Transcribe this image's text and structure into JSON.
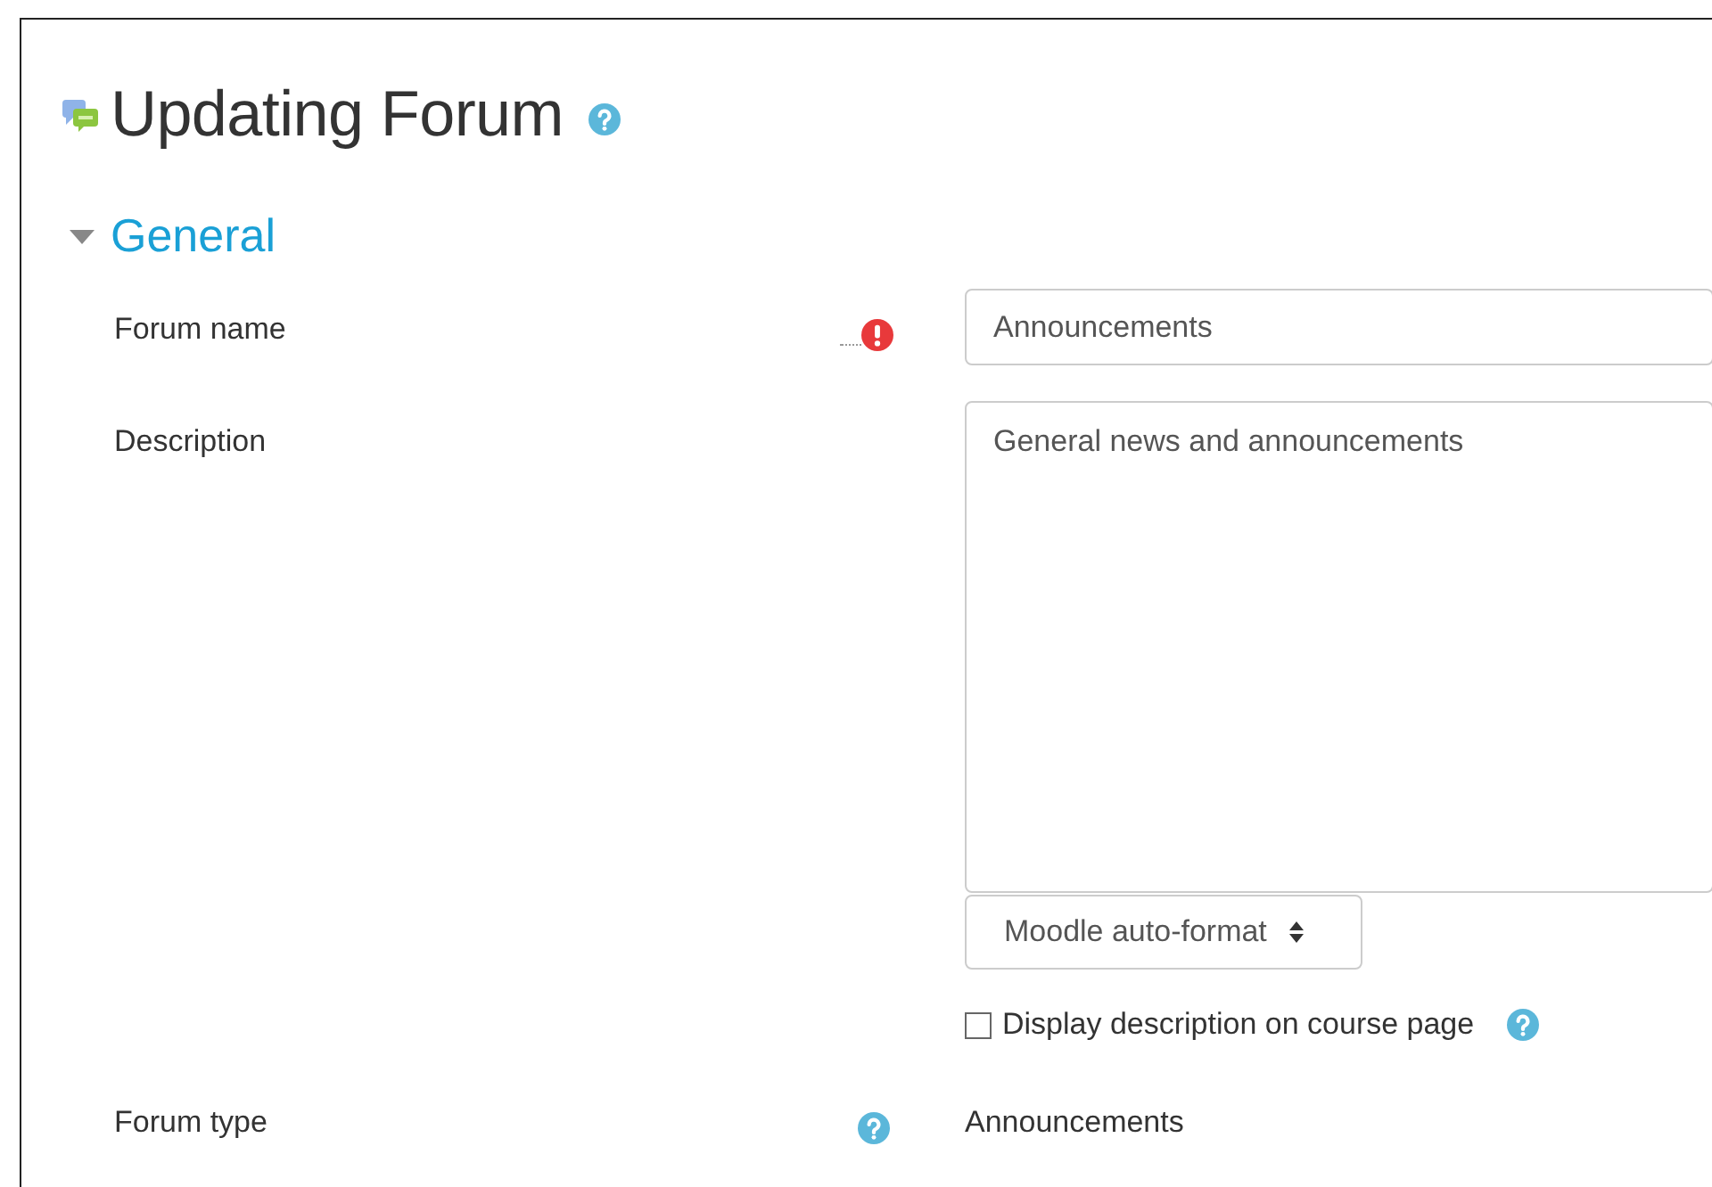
{
  "heading": {
    "title": "Updating Forum",
    "help": true
  },
  "section": {
    "title": "General",
    "expanded": true
  },
  "fields": [
    {
      "kind": "text",
      "label": "Forum name",
      "required": true,
      "help": false,
      "value": "Announcements"
    },
    {
      "kind": "editor",
      "label": "Description",
      "required": false,
      "help": false,
      "value": "General news and announcements",
      "format": "Moodle auto-format",
      "checkbox": {
        "label": "Display description on course page",
        "checked": false,
        "help": true
      }
    },
    {
      "kind": "static",
      "label": "Forum type",
      "required": false,
      "help": true,
      "value": "Announcements"
    }
  ]
}
